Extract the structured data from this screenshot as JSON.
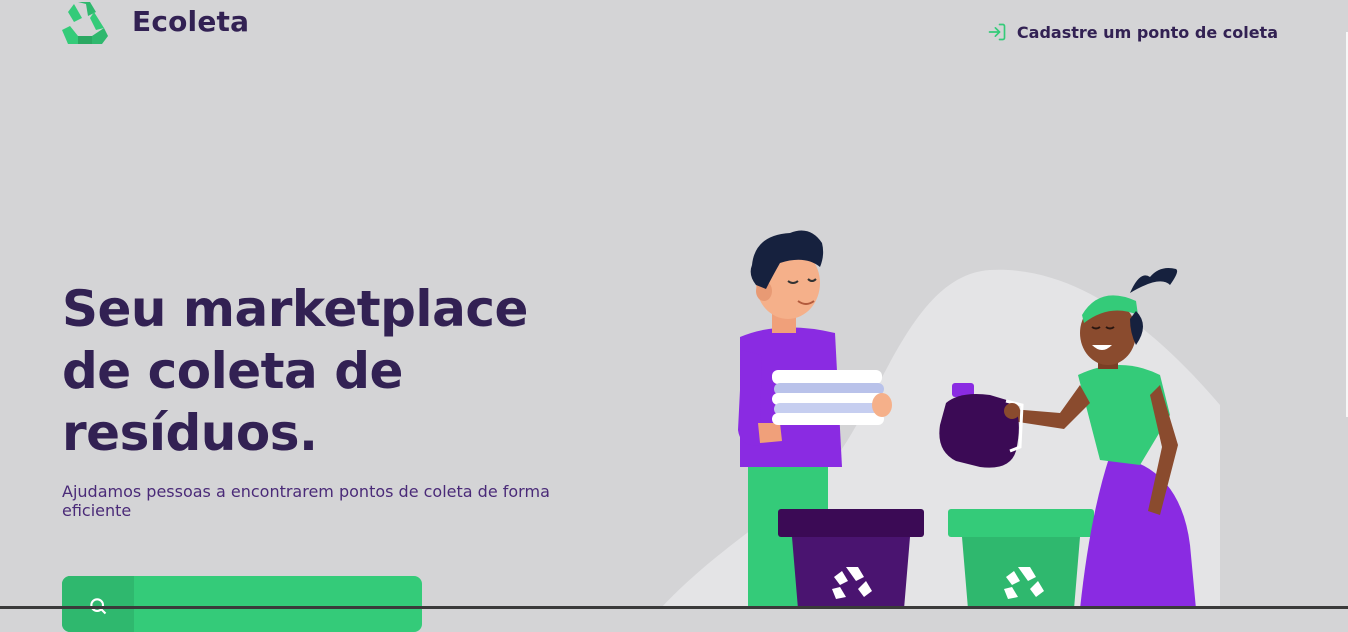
{
  "brand": {
    "name": "Ecoleta",
    "logo_icon": "recycle-icon",
    "color_green": "#34cb79",
    "color_purple": "#322153"
  },
  "header": {
    "register_link": {
      "label": "Cadastre um ponto de coleta",
      "icon": "log-in-icon"
    }
  },
  "hero": {
    "title": "Seu marketplace de coleta de resíduos.",
    "description": "Ajudamos pessoas a encontrarem pontos de coleta de forma eficiente"
  },
  "cta": {
    "label": "",
    "icon": "search-icon"
  },
  "illustration": {
    "name": "people-recycling-illustration"
  }
}
